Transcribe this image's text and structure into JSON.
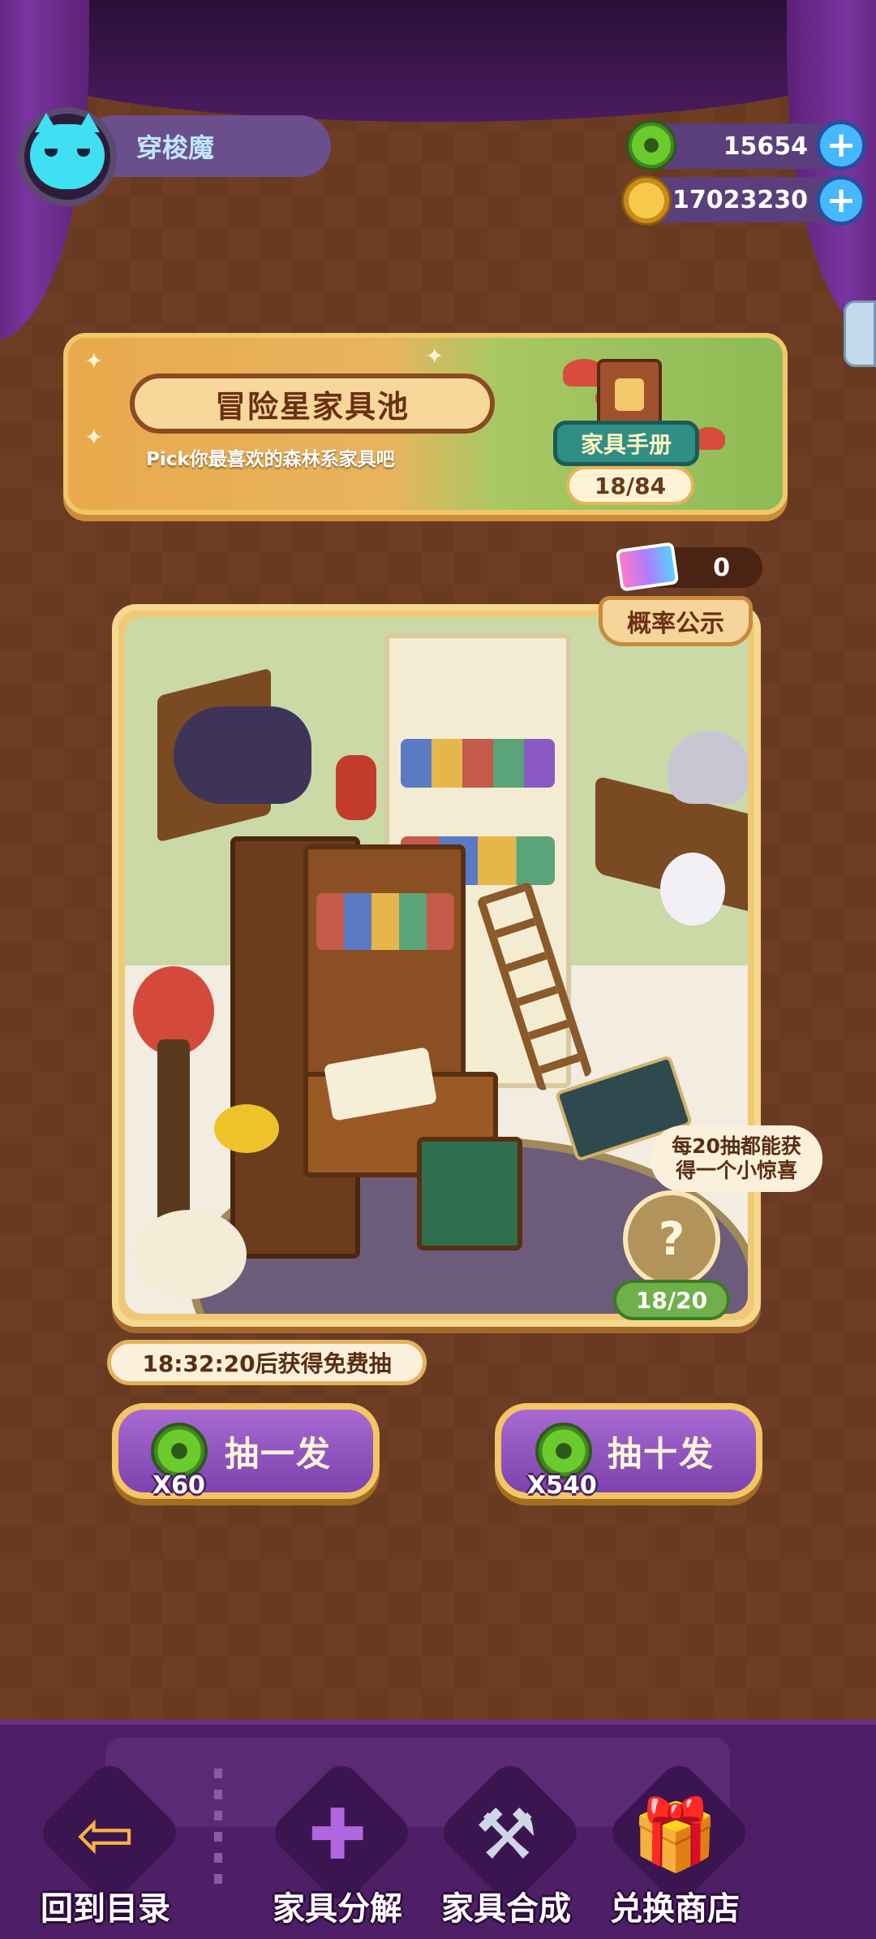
{
  "player": {
    "name": "穿梭魔"
  },
  "currencies": {
    "green_coin": "15654",
    "gold_coin": "17023230"
  },
  "banner": {
    "title": "冒险星家具池",
    "subtitle": "Pick你最喜欢的森林系家具吧",
    "handbook_label": "家具手册",
    "handbook_count": "18/84"
  },
  "ticket_count": "0",
  "showcase": {
    "probability_label": "概率公示",
    "bonus_tip": "每20抽都能获得一个小惊喜",
    "mystery_glyph": "?",
    "bonus_progress": "18/20"
  },
  "free_timer": "18:32:20后获得免费抽",
  "draw": {
    "single_label": "抽一发",
    "single_cost": "X60",
    "ten_label": "抽十发",
    "ten_cost": "X540"
  },
  "nav": {
    "back": "回到目录",
    "decompose": "家具分解",
    "craft": "家具合成",
    "shop": "兑换商店"
  },
  "icons": {
    "avatar": "cat-avatar-icon",
    "green_coin": "green-donut-coin-icon",
    "gold_coin": "gold-coin-icon",
    "plus": "plus-icon",
    "ticket": "ticket-icon",
    "book": "book-icon",
    "mystery": "question-icon",
    "back": "back-arrow-star-icon",
    "decompose": "puzzle-icon",
    "craft": "hammer-icon",
    "shop": "gift-icon"
  },
  "colors": {
    "background": "#6e3d24",
    "curtain": "#4a1c5e",
    "accent_gold": "#f3c565",
    "button_purple": "#8b50b8",
    "nav_bg": "#4e1f66"
  }
}
